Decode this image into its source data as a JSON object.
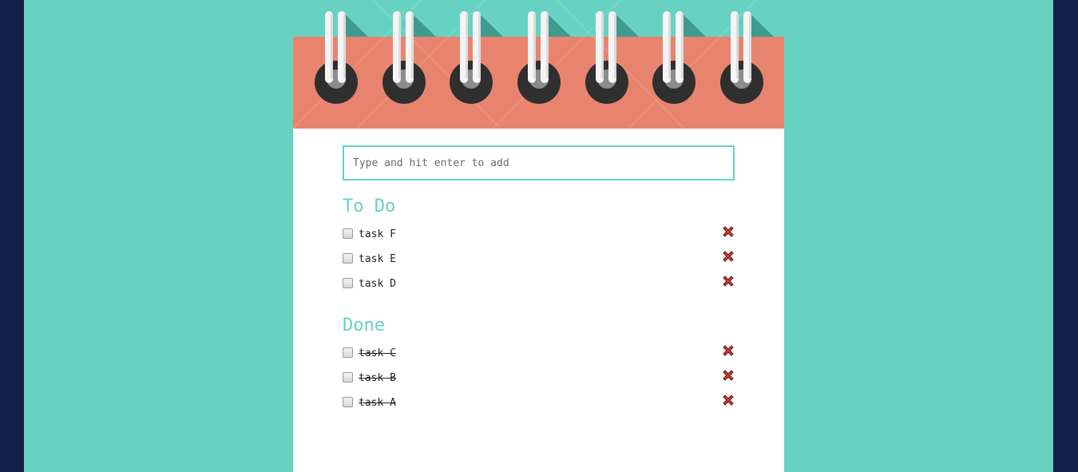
{
  "add_field": {
    "placeholder": "Type and hit enter to add",
    "value": ""
  },
  "todo": {
    "title": "To Do",
    "items": [
      {
        "label": "task F",
        "checked": false
      },
      {
        "label": "task E",
        "checked": false
      },
      {
        "label": "task D",
        "checked": false
      }
    ]
  },
  "done": {
    "title": "Done",
    "items": [
      {
        "label": "task C",
        "checked": false
      },
      {
        "label": "task B",
        "checked": false
      },
      {
        "label": "task A",
        "checked": false
      }
    ]
  },
  "icons": {
    "delete": "close-x-icon",
    "binding": "spiral-ring-icon"
  },
  "colors": {
    "outer_background": "#142048",
    "stage_background": "#67d2c2",
    "accent": "#67d2c2",
    "header": "#e8846e",
    "sheet": "#ffffff",
    "delete_icon": "#d83a3a"
  }
}
